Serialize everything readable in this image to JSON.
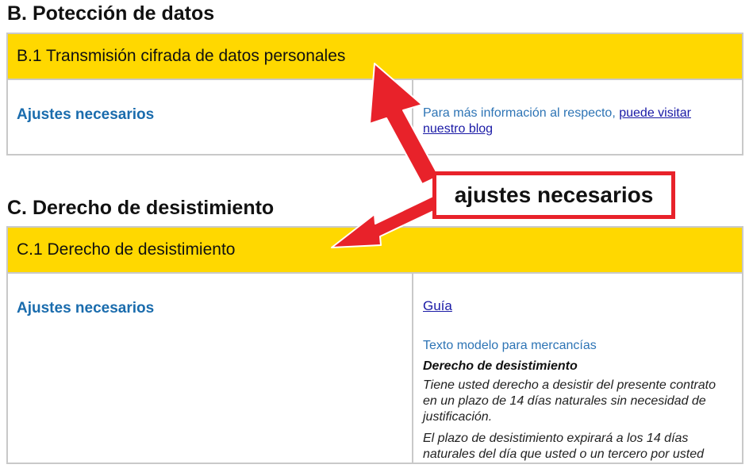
{
  "section_b": {
    "heading": "B. Potección de datos",
    "box_title": "B.1 Transmisión cifrada de datos personales",
    "settings_label": "Ajustes necesarios",
    "info_prefix": "Para más información al respecto, ",
    "info_link": "puede visitar nuestro blog"
  },
  "section_c": {
    "heading": "C. Derecho de desistimiento",
    "box_title": "C.1 Derecho de desistimiento",
    "settings_label": "Ajustes necesarios",
    "guide_link": "Guía",
    "template_label": "Texto modelo para mercancías",
    "template_title": "Derecho de desistimiento",
    "paragraph_1": "Tiene usted derecho a desistir del presente contrato en un plazo de 14 días naturales sin necesidad de justificación.",
    "paragraph_2": "El plazo de desistimiento expirará a los 14 días naturales del día que usted o un tercero por usted"
  },
  "annotation": {
    "label": "ajustes necesarios",
    "color": "#e8222a"
  }
}
